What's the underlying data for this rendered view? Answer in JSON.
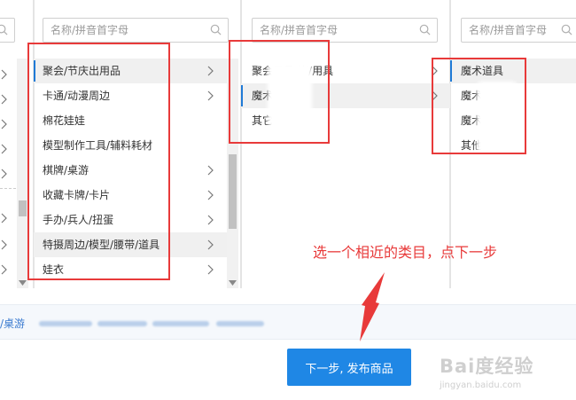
{
  "search": {
    "placeholder": "名称/拼音首字母"
  },
  "col1": {
    "items": [
      "",
      "",
      "",
      "",
      "",
      "",
      "",
      "",
      ""
    ]
  },
  "col2": {
    "items": [
      {
        "label": "聚会/节庆出用品",
        "has_children": true,
        "selected": true
      },
      {
        "label": "卡通/动漫周边",
        "has_children": true
      },
      {
        "label": "棉花娃娃",
        "has_children": false
      },
      {
        "label": "模型制作工具/辅料耗材",
        "has_children": false
      },
      {
        "label": "棋牌/桌游",
        "has_children": true
      },
      {
        "label": "收藏卡牌/卡片",
        "has_children": true
      },
      {
        "label": "手办/兵人/扭蛋",
        "has_children": true
      },
      {
        "label": "特摄周边/模型/腰带/道具",
        "has_children": true,
        "hover": true
      },
      {
        "label": "娃衣",
        "has_children": true
      }
    ]
  },
  "col3": {
    "items": [
      {
        "label": "聚会用品/饰/用具",
        "has_children": true
      },
      {
        "label": "魔术",
        "has_children": true,
        "selected": true
      },
      {
        "label": "其它",
        "has_children": false
      }
    ]
  },
  "col4": {
    "items": [
      {
        "label": "魔术道具",
        "selected": true
      },
      {
        "label": "魔术书",
        "selected": false
      },
      {
        "label": "魔术教学",
        "selected": false
      },
      {
        "label": "其他魔术",
        "selected": false
      }
    ]
  },
  "breadcrumb": {
    "text": "/桌游"
  },
  "next_button": {
    "label": "下一步, 发布商品"
  },
  "annotation": {
    "text": "选一个相近的类目，点下一步"
  },
  "watermark": {
    "brand": "Bai度经验",
    "url": "jingyan.baidu.com"
  },
  "colors": {
    "accent": "#1f87e5",
    "annotation_red": "#e83a3a",
    "selected_bar": "#1f7ad6"
  },
  "icons": {
    "search": "search-icon",
    "arrow": "chevron-right-icon"
  }
}
